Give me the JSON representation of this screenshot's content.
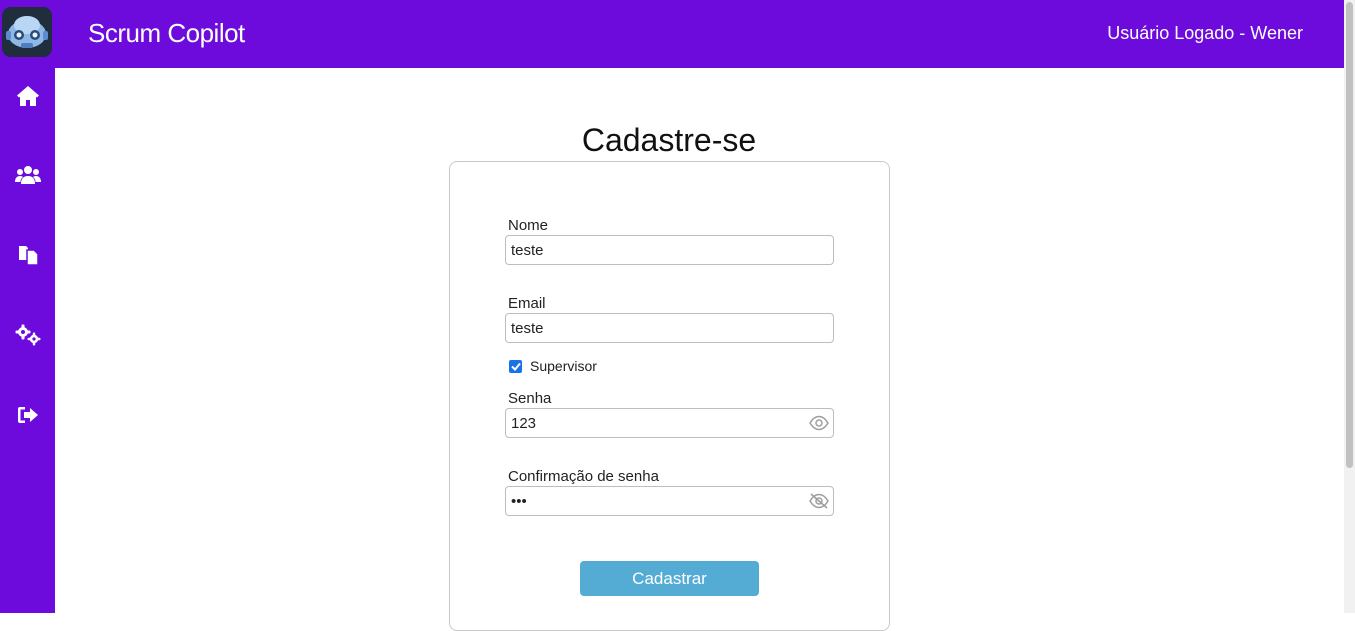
{
  "header": {
    "app_title": "Scrum Copilot",
    "user_label": "Usuário Logado - Wener",
    "brand_color": "#6c0bdb"
  },
  "sidebar": {
    "items": [
      {
        "icon": "home-icon"
      },
      {
        "icon": "users-icon"
      },
      {
        "icon": "clipboard-copy-icon"
      },
      {
        "icon": "cogs-icon"
      },
      {
        "icon": "sign-out-icon"
      }
    ]
  },
  "form": {
    "title": "Cadastre-se",
    "name_label": "Nome",
    "name_value": "teste",
    "email_label": "Email",
    "email_value": "teste",
    "supervisor_label": "Supervisor",
    "supervisor_checked": true,
    "password_label": "Senha",
    "password_value": "123",
    "confirm_label": "Confirmação de senha",
    "confirm_value": "•••",
    "submit_label": "Cadastrar",
    "submit_color": "#54acd4"
  }
}
